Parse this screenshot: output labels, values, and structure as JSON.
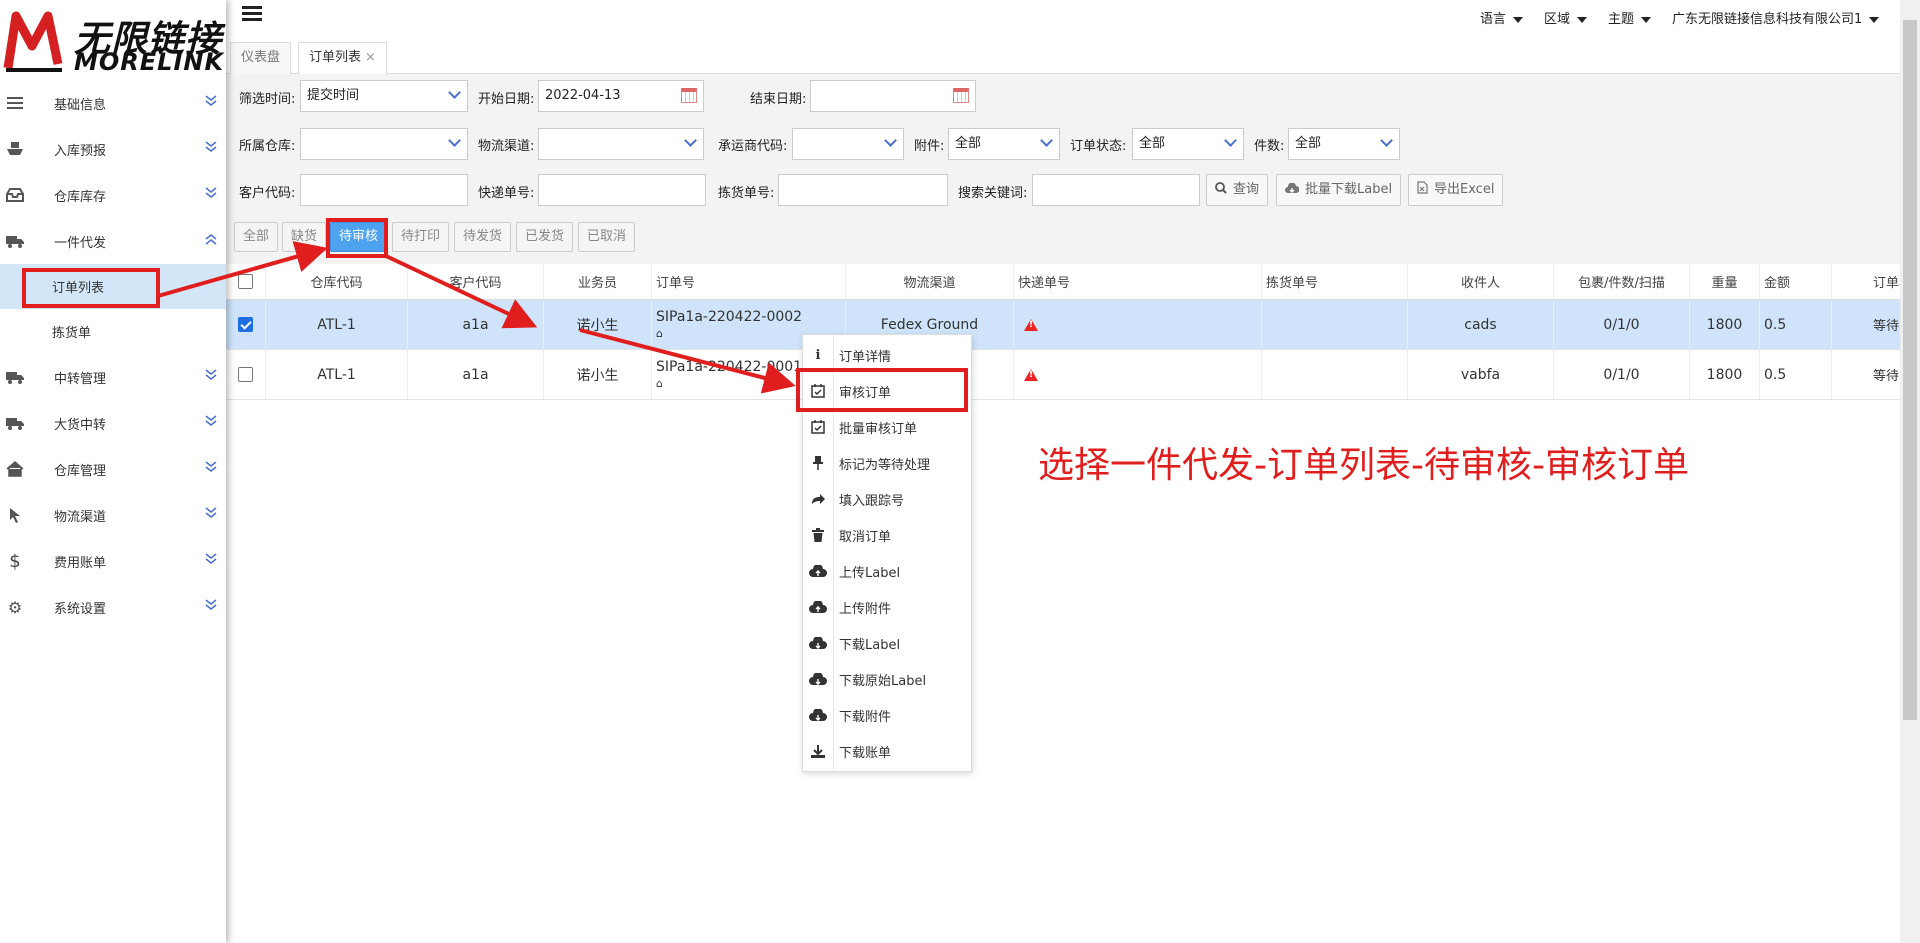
{
  "logo": {
    "cn": "无限链接",
    "en": "MORELINK"
  },
  "sidebar": {
    "items": [
      {
        "label": "基础信息",
        "icon": "list-icon"
      },
      {
        "label": "入库预报",
        "icon": "ship-icon"
      },
      {
        "label": "仓库库存",
        "icon": "inbox-icon"
      },
      {
        "label": "一件代发",
        "icon": "truck-icon"
      },
      {
        "label": "中转管理",
        "icon": "truck-icon"
      },
      {
        "label": "大货中转",
        "icon": "truck-icon"
      },
      {
        "label": "仓库管理",
        "icon": "home-icon"
      },
      {
        "label": "物流渠道",
        "icon": "cursor-icon"
      },
      {
        "label": "费用账单",
        "icon": "dollar-icon"
      },
      {
        "label": "系统设置",
        "icon": "gear-icon"
      }
    ],
    "sub_items": [
      {
        "label": "订单列表",
        "active": true
      },
      {
        "label": "拣货单",
        "active": false
      }
    ]
  },
  "topbar": {
    "language": "语言",
    "region": "区域",
    "theme": "主题",
    "company": "广东无限链接信息科技有限公司1"
  },
  "tabs": [
    {
      "label": "仪表盘",
      "active": false
    },
    {
      "label": "订单列表",
      "active": true,
      "close": "×"
    }
  ],
  "filters": {
    "filter_time_label": "筛选时间:",
    "filter_time_value": "提交时间",
    "start_date_label": "开始日期:",
    "start_date_value": "2022-04-13",
    "end_date_label": "结束日期:",
    "end_date_value": "",
    "warehouse_label": "所属仓库:",
    "channel_label": "物流渠道:",
    "carrier_label": "承运商代码:",
    "attachment_label": "附件:",
    "attachment_value": "全部",
    "order_status_label": "订单状态:",
    "order_status_value": "全部",
    "pieces_label": "件数:",
    "pieces_value": "全部",
    "customer_code_label": "客户代码:",
    "tracking_label": "快递单号:",
    "picking_label": "拣货单号:",
    "keyword_label": "搜索关键词:",
    "search_btn": "查询",
    "batch_download_btn": "批量下载Label",
    "export_btn": "导出Excel"
  },
  "status_tabs": [
    {
      "label": "全部",
      "active": false
    },
    {
      "label": "缺货",
      "active": false
    },
    {
      "label": "待审核",
      "active": true
    },
    {
      "label": "待打印",
      "active": false
    },
    {
      "label": "待发货",
      "active": false
    },
    {
      "label": "已发货",
      "active": false
    },
    {
      "label": "已取消",
      "active": false
    }
  ],
  "table": {
    "headers": [
      "仓库代码",
      "客户代码",
      "业务员",
      "订单号",
      "物流渠道",
      "快递单号",
      "拣货单号",
      "收件人",
      "包裹/件数/扫描",
      "重量",
      "金额",
      "订单状态"
    ],
    "rows": [
      {
        "checked": true,
        "warehouse": "ATL-1",
        "customer": "a1a",
        "salesman": "诺小生",
        "order_no": "SIPa1a-220422-0002",
        "channel": "Fedex Ground",
        "tracking": "",
        "picking": "",
        "recipient": "cads",
        "pkgs": "0/1/0",
        "weight": "1800",
        "amount": "0.5",
        "status": "等待审核"
      },
      {
        "checked": false,
        "warehouse": "ATL-1",
        "customer": "a1a",
        "salesman": "诺小生",
        "order_no": "SIPa1a-220422-0001",
        "channel": "",
        "tracking": "",
        "picking": "",
        "recipient": "vabfa",
        "pkgs": "0/1/0",
        "weight": "1800",
        "amount": "0.5",
        "status": "等待审核"
      }
    ]
  },
  "context_menu": [
    {
      "label": "订单详情",
      "icon": "info-icon"
    },
    {
      "label": "审核订单",
      "icon": "calendar-check-icon"
    },
    {
      "label": "批量审核订单",
      "icon": "calendar-check-icon"
    },
    {
      "label": "标记为等待处理",
      "icon": "pin-icon"
    },
    {
      "label": "填入跟踪号",
      "icon": "share-icon"
    },
    {
      "label": "取消订单",
      "icon": "trash-icon"
    },
    {
      "label": "上传Label",
      "icon": "cloud-upload-icon"
    },
    {
      "label": "上传附件",
      "icon": "cloud-upload-icon"
    },
    {
      "label": "下载Label",
      "icon": "cloud-download-icon"
    },
    {
      "label": "下载原始Label",
      "icon": "cloud-download-icon"
    },
    {
      "label": "下载附件",
      "icon": "cloud-download-icon"
    },
    {
      "label": "下载账单",
      "icon": "download-icon"
    }
  ],
  "annotation": {
    "instruction": "选择一件代发-订单列表-待审核-审核订单",
    "color": "#e01e1e"
  }
}
